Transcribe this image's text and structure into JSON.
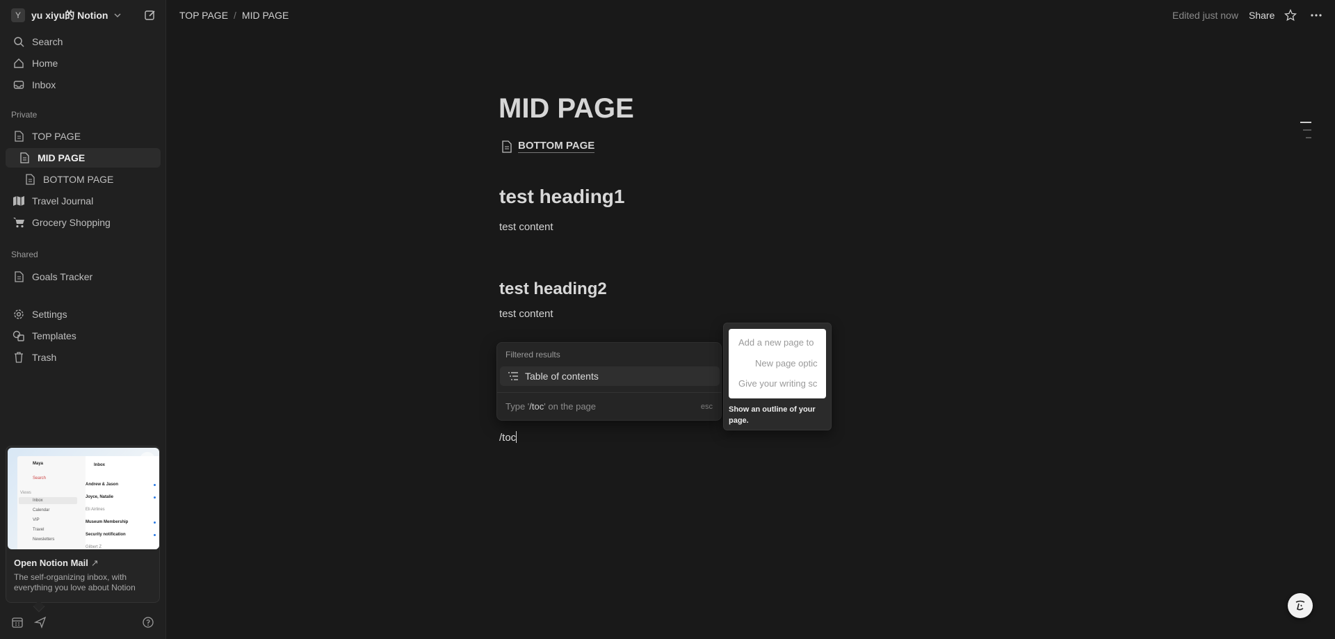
{
  "workspace": {
    "avatar_letter": "Y",
    "name": "yu xiyu的 Notion"
  },
  "sidebar": {
    "top_items": [
      {
        "label": "Search",
        "icon": "search-icon"
      },
      {
        "label": "Home",
        "icon": "home-icon"
      },
      {
        "label": "Inbox",
        "icon": "inbox-icon"
      }
    ],
    "private_label": "Private",
    "private_items": [
      {
        "label": "TOP PAGE",
        "icon": "page-icon"
      },
      {
        "label": "MID PAGE",
        "icon": "page-icon",
        "active": true
      },
      {
        "label": "BOTTOM PAGE",
        "icon": "page-icon"
      },
      {
        "label": "Travel Journal",
        "icon": "map-icon"
      },
      {
        "label": "Grocery Shopping",
        "icon": "cart-icon"
      }
    ],
    "shared_label": "Shared",
    "shared_items": [
      {
        "label": "Goals Tracker",
        "icon": "page-icon"
      }
    ],
    "bottom_items": [
      {
        "label": "Settings",
        "icon": "gear-icon"
      },
      {
        "label": "Templates",
        "icon": "templates-icon"
      },
      {
        "label": "Trash",
        "icon": "trash-icon"
      }
    ]
  },
  "mail_card": {
    "title": "Open Notion Mail",
    "arrow": "↗",
    "description": "The self-organizing inbox, with everything you love about Notion",
    "preview": {
      "user": "Maya",
      "search": "Search",
      "views": "Views",
      "nav": [
        "Inbox",
        "Calendar",
        "VIP",
        "Travel",
        "Newsletters"
      ],
      "inbox_title": "Inbox",
      "messages": [
        "Andrew & Jason",
        "Joyce, Natalie",
        "Eli Airlines",
        "Museum Membership",
        "Security notification",
        "Gilbert Z"
      ]
    }
  },
  "topbar": {
    "breadcrumbs": [
      "TOP PAGE",
      "MID PAGE"
    ],
    "edited": "Edited just now",
    "share": "Share"
  },
  "page": {
    "title": "MID PAGE",
    "child_page": "BOTTOM PAGE",
    "heading1": "test heading1",
    "content1": "test content",
    "heading2": "test heading2",
    "content2": "test content",
    "typed_text": "/toc"
  },
  "slash_menu": {
    "header": "Filtered results",
    "item": "Table of contents",
    "hint_prefix": "Type '",
    "hint_code": "/toc",
    "hint_suffix": "' on the page",
    "esc": "esc"
  },
  "preview_tooltip": {
    "lines": [
      "Add a new page to",
      "New page optic",
      "Give your writing sc"
    ],
    "description": "Show an outline of your page."
  },
  "colors": {
    "background": "#191919",
    "sidebar": "#202020",
    "menu": "#252525"
  }
}
